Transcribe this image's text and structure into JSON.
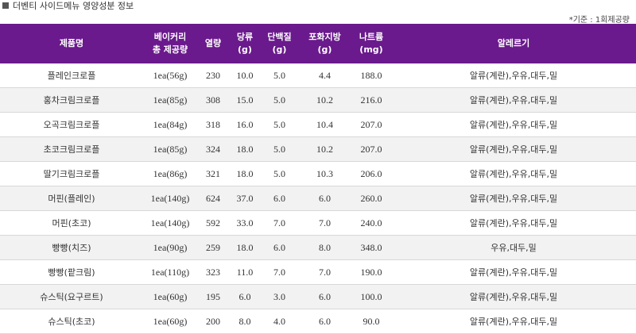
{
  "title": "더벤티 사이드메뉴 영양성분 정보",
  "note": "*기준 : 1회제공량",
  "columns": [
    {
      "line1": "제품명",
      "line2": ""
    },
    {
      "line1": "베이커리",
      "line2": "총 제공량"
    },
    {
      "line1": "열량",
      "line2": ""
    },
    {
      "line1": "당류",
      "line2": "(g)"
    },
    {
      "line1": "단백질",
      "line2": "(g)"
    },
    {
      "line1": "포화지방",
      "line2": "(g)"
    },
    {
      "line1": "나트륨",
      "line2": "(mg)"
    },
    {
      "line1": "알레르기",
      "line2": ""
    }
  ],
  "rows": [
    [
      "플레인크로플",
      "1ea(56g)",
      "230",
      "10.0",
      "5.0",
      "4.4",
      "188.0",
      "알류(계란),우유,대두,밀"
    ],
    [
      "홍차크림크로플",
      "1ea(85g)",
      "308",
      "15.0",
      "5.0",
      "10.2",
      "216.0",
      "알류(계란),우유,대두,밀"
    ],
    [
      "오곡크림크로플",
      "1ea(84g)",
      "318",
      "16.0",
      "5.0",
      "10.4",
      "207.0",
      "알류(계란),우유,대두,밀"
    ],
    [
      "초코크림크로플",
      "1ea(85g)",
      "324",
      "18.0",
      "5.0",
      "10.2",
      "207.0",
      "알류(계란),우유,대두,밀"
    ],
    [
      "딸기크림크로플",
      "1ea(86g)",
      "321",
      "18.0",
      "5.0",
      "10.3",
      "206.0",
      "알류(계란),우유,대두,밀"
    ],
    [
      "머핀(플레인)",
      "1ea(140g)",
      "624",
      "37.0",
      "6.0",
      "6.0",
      "260.0",
      "알류(계란),우유,대두,밀"
    ],
    [
      "머핀(초코)",
      "1ea(140g)",
      "592",
      "33.0",
      "7.0",
      "7.0",
      "240.0",
      "알류(계란),우유,대두,밀"
    ],
    [
      "빵빵(치즈)",
      "1ea(90g)",
      "259",
      "18.0",
      "6.0",
      "8.0",
      "348.0",
      "우유,대두,밀"
    ],
    [
      "빵빵(팥크림)",
      "1ea(110g)",
      "323",
      "11.0",
      "7.0",
      "7.0",
      "190.0",
      "알류(계란),우유,대두,밀"
    ],
    [
      "슈스틱(요구르트)",
      "1ea(60g)",
      "195",
      "6.0",
      "3.0",
      "6.0",
      "100.0",
      "알류(계란),우유,대두,밀"
    ],
    [
      "슈스틱(초코)",
      "1ea(60g)",
      "200",
      "8.0",
      "4.0",
      "6.0",
      "90.0",
      "알류(계란),우유,대두,밀"
    ]
  ],
  "colors": {
    "header_bg": "#6a1a8c",
    "header_text": "#ffffff",
    "stripe": "#f2f2f2"
  }
}
